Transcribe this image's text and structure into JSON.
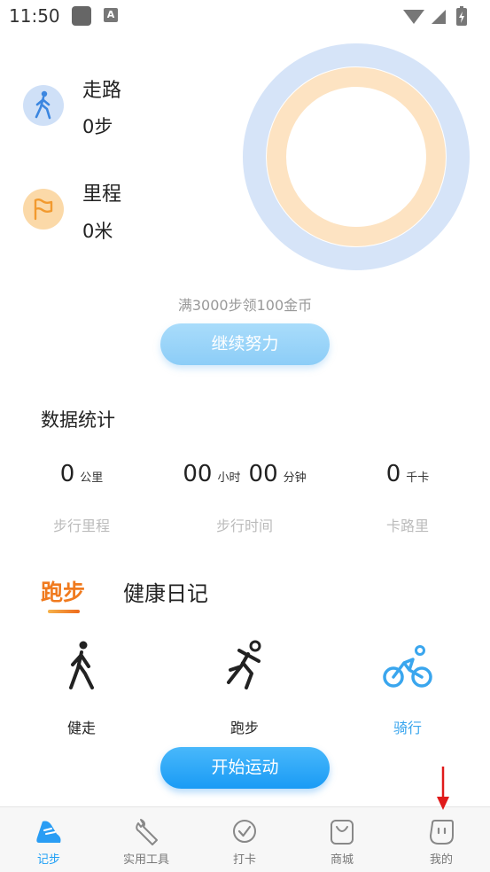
{
  "status_bar": {
    "time": "11:50",
    "a_glyph": "A"
  },
  "stats": {
    "walk": {
      "label": "走路",
      "value": "0步",
      "icon": "walker-icon"
    },
    "distance": {
      "label": "里程",
      "value": "0米",
      "icon": "flag-icon"
    }
  },
  "goal_text": "满3000步领100金币",
  "continue_button": "继续努力",
  "data_section": {
    "title": "数据统计",
    "items": [
      {
        "parts": [
          {
            "num": "0",
            "unit": "公里"
          }
        ],
        "label": "步行里程"
      },
      {
        "parts": [
          {
            "num": "00",
            "unit": "小时"
          },
          {
            "num": "00",
            "unit": "分钟"
          }
        ],
        "label": "步行时间"
      },
      {
        "parts": [
          {
            "num": "0",
            "unit": "千卡"
          }
        ],
        "label": "卡路里"
      }
    ]
  },
  "tabs": {
    "active": "跑步",
    "other": "健康日记"
  },
  "sports": [
    {
      "label": "健走",
      "icon": "walking-figure-icon",
      "color": "#222222"
    },
    {
      "label": "跑步",
      "icon": "running-figure-icon",
      "color": "#222222"
    },
    {
      "label": "骑行",
      "icon": "bicycle-icon",
      "color": "#3aa6ee"
    }
  ],
  "start_button": "开始运动",
  "bottom_nav": [
    {
      "label": "记步",
      "icon": "shoe-icon",
      "active": true
    },
    {
      "label": "实用工具",
      "icon": "wrench-icon",
      "active": false
    },
    {
      "label": "打卡",
      "icon": "checkmark-shield-icon",
      "active": false
    },
    {
      "label": "商城",
      "icon": "shopping-bag-icon",
      "active": false
    },
    {
      "label": "我的",
      "icon": "face-bubble-icon",
      "active": false
    }
  ],
  "colors": {
    "accent": "#1f9ff5",
    "orange": "#f07a1e",
    "ring_outer": "#d6e4f8",
    "ring_inner": "#fde3c2"
  }
}
